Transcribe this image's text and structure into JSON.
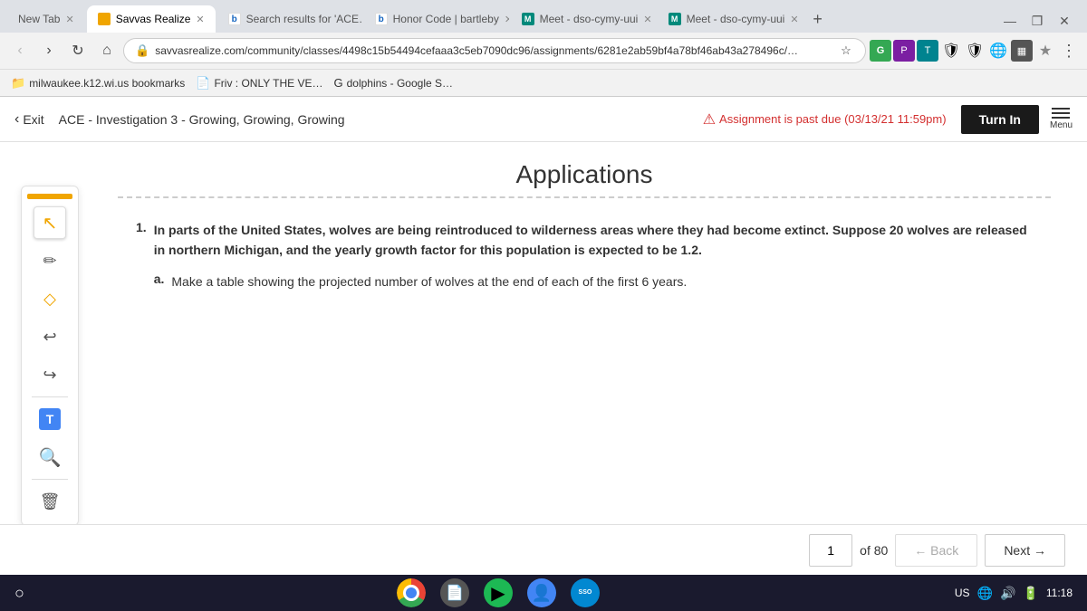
{
  "browser": {
    "tabs": [
      {
        "id": "new-tab",
        "label": "New Tab",
        "favicon_type": "none",
        "active": false
      },
      {
        "id": "savvas",
        "label": "Savvas Realize",
        "favicon_type": "orange",
        "active": true
      },
      {
        "id": "search",
        "label": "Search results for 'ACE…",
        "favicon_type": "b",
        "active": false
      },
      {
        "id": "honor",
        "label": "Honor Code | bartleby",
        "favicon_type": "b",
        "active": false
      },
      {
        "id": "meet1",
        "label": "Meet - dso-cymy-uui",
        "favicon_type": "meet",
        "active": false
      },
      {
        "id": "meet2",
        "label": "Meet - dso-cymy-uui",
        "favicon_type": "meet",
        "active": false
      }
    ],
    "url": "savvasrealize.com/community/classes/4498c15b54494cefaaa3c5eb7090dc96/assignments/6281e2ab59bf4a78bf46ab43a278496c/…",
    "bookmarks": [
      {
        "label": "milwaukee.k12.wi.us bookmarks",
        "type": "folder"
      },
      {
        "label": "Friv : ONLY THE VE…",
        "type": "folder"
      },
      {
        "label": "dolphins - Google S…",
        "type": "page"
      }
    ]
  },
  "header": {
    "exit_label": "Exit",
    "breadcrumb": "ACE - Investigation 3 - Growing, Growing, Growing",
    "assignment_due_text": "Assignment is past due (03/13/21 11:59pm)",
    "turn_in_label": "Turn In",
    "menu_label": "Menu"
  },
  "toolbar": {
    "tools": [
      {
        "id": "select",
        "icon": "↖",
        "active": true
      },
      {
        "id": "pencil",
        "icon": "✏",
        "active": false
      },
      {
        "id": "eraser",
        "icon": "◇",
        "active": false
      },
      {
        "id": "undo",
        "icon": "↩",
        "active": false
      },
      {
        "id": "redo",
        "icon": "↪",
        "active": false
      },
      {
        "id": "text",
        "icon": "T",
        "active": false,
        "type": "text"
      },
      {
        "id": "zoom",
        "icon": "⊕",
        "active": false
      }
    ],
    "delete_icon": "🗑"
  },
  "content": {
    "title": "Applications",
    "question_1": {
      "number": "1.",
      "text": "In parts of the United States, wolves are being reintroduced to wilderness areas where they had become extinct. Suppose 20 wolves are released in northern Michigan, and the yearly growth factor for this population is expected to be 1.2.",
      "sub_a": {
        "label": "a.",
        "text": "Make a table showing the projected number of wolves at the end of each of the first 6 years."
      }
    }
  },
  "footer": {
    "current_page": "1",
    "total_pages": "80",
    "back_label": "← Back",
    "next_label": "Next →",
    "of_label": "of"
  },
  "taskbar": {
    "time": "11:18",
    "region": "US"
  }
}
